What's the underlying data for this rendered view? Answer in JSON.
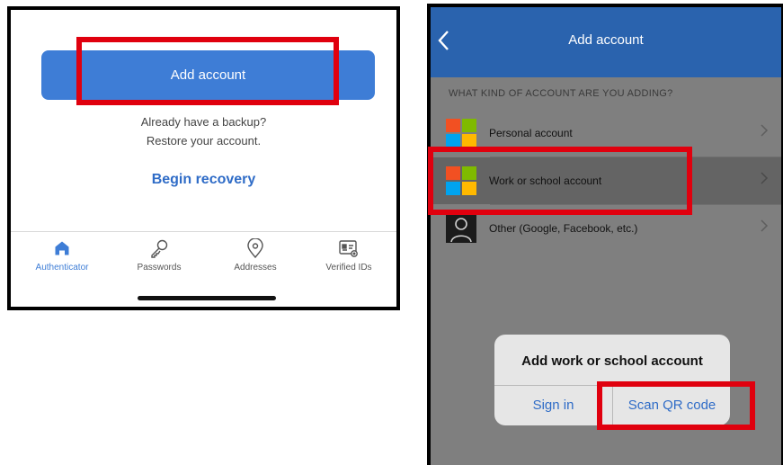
{
  "left": {
    "add_account_label": "Add account",
    "backup_line1": "Already have a backup?",
    "backup_line2": "Restore your account.",
    "begin_recovery": "Begin recovery",
    "nav": [
      {
        "label": "Authenticator",
        "icon": "home-icon",
        "active": true
      },
      {
        "label": "Passwords",
        "icon": "key-icon",
        "active": false
      },
      {
        "label": "Addresses",
        "icon": "location-pin-icon",
        "active": false
      },
      {
        "label": "Verified IDs",
        "icon": "id-card-icon",
        "active": false
      }
    ]
  },
  "right": {
    "header_title": "Add account",
    "section_label": "WHAT KIND OF ACCOUNT ARE YOU ADDING?",
    "accounts": [
      {
        "label": "Personal account",
        "icon": "microsoft-logo-icon"
      },
      {
        "label": "Work or school account",
        "icon": "microsoft-logo-icon"
      },
      {
        "label": "Other (Google, Facebook, etc.)",
        "icon": "person-icon"
      }
    ],
    "dialog": {
      "title": "Add work or school account",
      "sign_in": "Sign in",
      "scan_qr": "Scan QR code"
    }
  },
  "colors": {
    "accent_blue": "#3e7dd6",
    "header_blue": "#2a63ae",
    "highlight_red": "#e0000e",
    "ms_red": "#f25022",
    "ms_green": "#7fba00",
    "ms_blue": "#00a4ef",
    "ms_yellow": "#ffb900"
  }
}
